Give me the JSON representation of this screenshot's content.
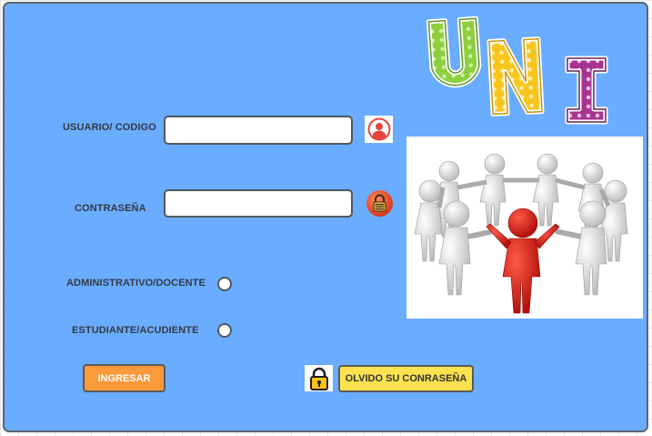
{
  "logo": {
    "letters": [
      "U",
      "N",
      "I"
    ],
    "colors": [
      "#8dcf3f",
      "#f8c51d",
      "#a7358f"
    ]
  },
  "form": {
    "user_label": "USUARIO/ CODIGO",
    "user_value": "",
    "password_label": "CONTRASEÑA",
    "password_value": "",
    "role_admin_label": "ADMINISTRATIVO/DOCENTE",
    "role_student_label": "ESTUDIANTE/ACUDIENTE"
  },
  "buttons": {
    "login_label": "INGRESAR",
    "forgot_label": "OLVIDO SU CONRASEÑA"
  },
  "icons": {
    "user": "user-icon",
    "password_lock": "lock-icon",
    "forgot_lock": "padlock-icon",
    "illustration": "people-circle-illustration"
  },
  "colors": {
    "panel": "#6aacff",
    "login_button": "#fb9a3a",
    "forgot_button": "#fde24f",
    "avatar": "#e8453c"
  }
}
